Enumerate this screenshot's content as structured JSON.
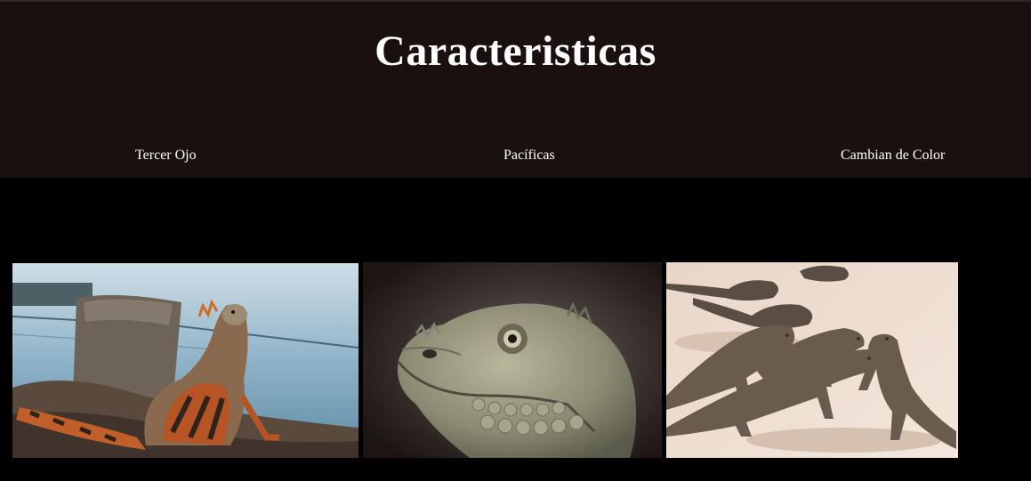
{
  "header": {
    "title": "Caracteristicas",
    "nav": [
      {
        "label": "Tercer Ojo"
      },
      {
        "label": "Pacíficas"
      },
      {
        "label": "Cambian de Color"
      }
    ]
  },
  "colors": {
    "header_bg": "#1a1010",
    "page_bg": "#000000",
    "text": "#ffffff"
  }
}
